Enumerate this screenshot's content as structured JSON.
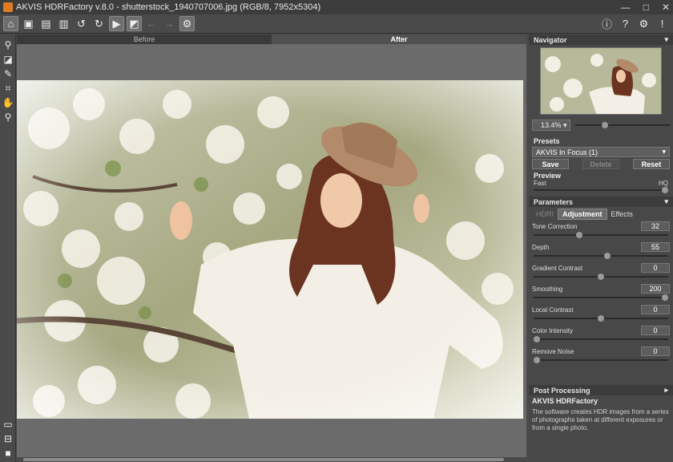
{
  "window": {
    "title": "AKVIS HDRFactory v.8.0 - shutterstock_1940707006.jpg (RGB/8, 7952x5304)",
    "controls": [
      "—",
      "□",
      "✕"
    ]
  },
  "toolbar": {
    "icons": [
      "home-icon",
      "open-icon",
      "save-icon",
      "print-icon",
      "undo-icon",
      "redo-icon",
      "run-icon",
      "before-after-icon",
      "back-icon",
      "forward-icon",
      "batch-icon"
    ],
    "right_icons": [
      "info-icon",
      "help-icon",
      "settings-icon",
      "notifications-icon"
    ]
  },
  "left_tools": [
    "wand-icon",
    "eraser-icon",
    "brush-icon",
    "crop-icon",
    "hand-icon",
    "zoom-icon"
  ],
  "canvas": {
    "tab_before": "Before",
    "tab_after": "After"
  },
  "navigator": {
    "title": "Navigator",
    "zoom": "13.4%",
    "zoom_level": 0.3
  },
  "presets": {
    "title": "Presets",
    "selected": "AKVIS In Focus (1)",
    "save": "Save",
    "delete": "Delete",
    "reset": "Reset"
  },
  "preview": {
    "title": "Preview",
    "fast": "Fast",
    "hq": "HQ"
  },
  "parameters": {
    "title": "Parameters",
    "tabs": [
      "HDRI",
      "Adjustment",
      "Effects"
    ],
    "active_tab": "Adjustment",
    "items": [
      {
        "label": "Tone Correction",
        "value": "32",
        "level": 0.33
      },
      {
        "label": "Depth",
        "value": "55",
        "level": 0.55
      },
      {
        "label": "Gradient Contrast",
        "value": "0",
        "level": 0.5
      },
      {
        "label": "Smoothing",
        "value": "200",
        "level": 1.0
      },
      {
        "label": "Local Contrast",
        "value": "0",
        "level": 0.5
      },
      {
        "label": "Color Intensity",
        "value": "0",
        "level": 0.0
      },
      {
        "label": "Remove Noise",
        "value": "0",
        "level": 0.0
      }
    ]
  },
  "post_processing": {
    "title": "Post Processing"
  },
  "info": {
    "title": "AKVIS HDRFactory",
    "text": "The software creates HDR images from a series of photographs taken at different exposures or from a single photo."
  },
  "colors": {
    "accent": "#e07b22",
    "panel": "#484848"
  }
}
